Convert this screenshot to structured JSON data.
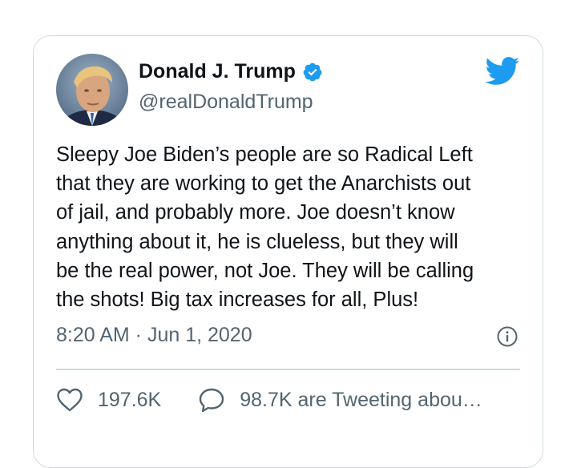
{
  "tweet": {
    "author_name": "Donald J. Trump",
    "handle": "@realDonaldTrump",
    "verified_icon": "verified-badge-icon",
    "brand_icon": "twitter-bird-icon",
    "text": "Sleepy Joe Biden’s people are so Radical Left\nthat they are working to get the Anarchists out\nof jail, and probably more. Joe doesn’t know\nanything about it, he is clueless, but they will\nbe the real power, not Joe. They will be calling\nthe shots! Big tax increases for all, Plus!",
    "timestamp": "8:20 AM · Jun 1, 2020",
    "info_icon": "info-icon"
  },
  "actions": {
    "likes_icon": "heart-icon",
    "likes_count": "197.6K",
    "replies_icon": "speech-bubble-icon",
    "tweeting_label": "98.7K are Tweeting abou…"
  },
  "colors": {
    "brand_blue": "#1d9bf0",
    "text_primary": "#0f1419",
    "text_secondary": "#536471",
    "border": "#cfd9de"
  }
}
